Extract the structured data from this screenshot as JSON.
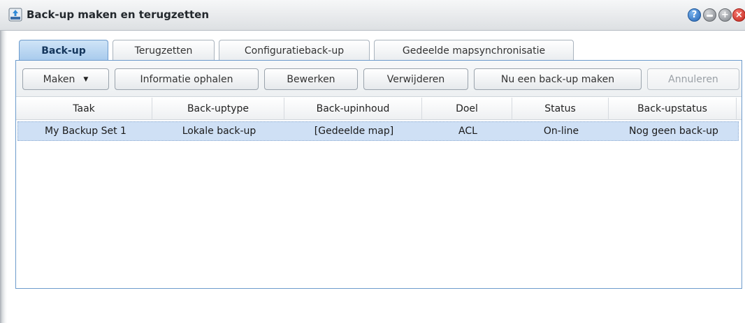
{
  "window": {
    "title": "Back-up maken en terugzetten",
    "app_icon": "backup-app-icon",
    "controls": {
      "help": "?",
      "minimize": "minimize-icon",
      "maximize": "+",
      "close": "×"
    }
  },
  "tabs": [
    {
      "label": "Back-up",
      "active": true
    },
    {
      "label": "Terugzetten",
      "active": false
    },
    {
      "label": "Configuratieback-up",
      "active": false
    },
    {
      "label": "Gedeelde mapsynchronisatie",
      "active": false
    }
  ],
  "toolbar": {
    "create": {
      "label": "Maken",
      "icon": "chevron-down-icon"
    },
    "info": {
      "label": "Informatie ophalen"
    },
    "edit": {
      "label": "Bewerken"
    },
    "delete": {
      "label": "Verwijderen"
    },
    "backup_now": {
      "label": "Nu een back-up maken"
    },
    "cancel": {
      "label": "Annuleren",
      "disabled": true
    }
  },
  "table": {
    "columns": [
      "Taak",
      "Back-uptype",
      "Back-upinhoud",
      "Doel",
      "Status",
      "Back-upstatus"
    ],
    "rows": [
      {
        "task": "My Backup Set 1",
        "type": "Lokale back-up",
        "content": "[Gedeelde map]",
        "target": "ACL",
        "status": "On-line",
        "backup_status": "Nog geen back-up",
        "selected": true
      }
    ]
  },
  "colors": {
    "accent": "#6d9bcc",
    "selected_row": "#cfe0f5",
    "active_tab": "#a6c9ec",
    "close_button": "#c3261c",
    "help_button": "#2767b7"
  }
}
